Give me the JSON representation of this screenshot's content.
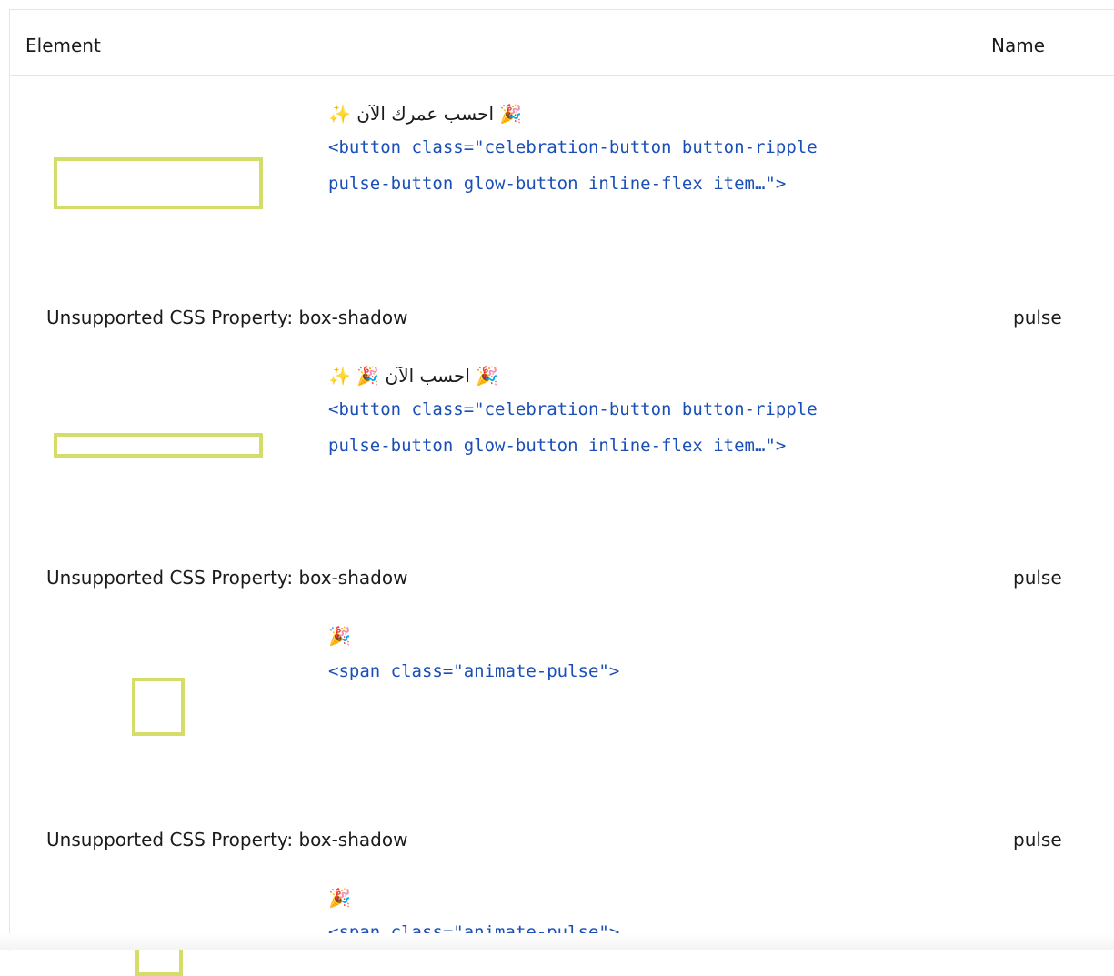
{
  "header": {
    "element_label": "Element",
    "name_label": "Name"
  },
  "rows": [
    {
      "label": "✨ احسب عمرك الآن 🎉",
      "code_line1": "<button class=\"celebration-button button-ripple",
      "code_line2": "pulse-button glow-button inline-flex item…\">",
      "issue": "Unsupported CSS Property: box-shadow",
      "issue_name": "pulse"
    },
    {
      "label": "✨ 🎉 احسب الآن 🎉",
      "code_line1": "<button class=\"celebration-button button-ripple",
      "code_line2": "pulse-button glow-button inline-flex item…\">",
      "issue": "Unsupported CSS Property: box-shadow",
      "issue_name": "pulse"
    },
    {
      "label": "🎉",
      "code_line1": "<span class=\"animate-pulse\">",
      "issue": "Unsupported CSS Property: box-shadow",
      "issue_name": "pulse"
    },
    {
      "label": "🎉",
      "code_line1": "<span class=\"animate-pulse\">"
    }
  ],
  "colors": {
    "thumb_border": "#d4dd6a",
    "code_text": "#1a4fb8",
    "divider": "#e5e5e5"
  }
}
